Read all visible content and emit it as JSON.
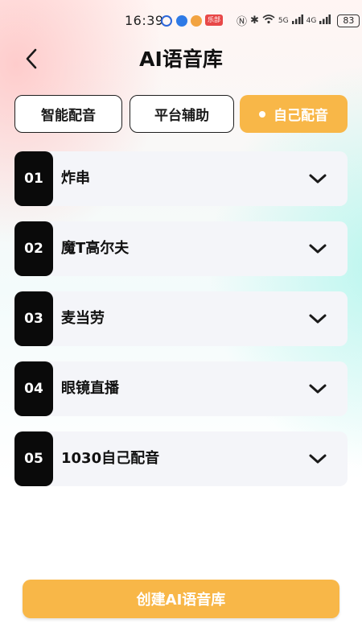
{
  "status_bar": {
    "time": "16:39",
    "badge": "乐部",
    "battery": "83",
    "net1": "5G",
    "net2": "4G"
  },
  "header": {
    "title": "AI语音库"
  },
  "tabs": [
    {
      "label": "智能配音",
      "active": false
    },
    {
      "label": "平台辅助",
      "active": false
    },
    {
      "label": "自己配音",
      "active": true
    }
  ],
  "items": [
    {
      "num": "01",
      "label": "炸串"
    },
    {
      "num": "02",
      "label": "魔T高尔夫"
    },
    {
      "num": "03",
      "label": "麦当劳"
    },
    {
      "num": "04",
      "label": "眼镜直播"
    },
    {
      "num": "05",
      "label": "1030自己配音"
    }
  ],
  "footer": {
    "create_label": "创建AI语音库"
  },
  "colors": {
    "accent": "#f8b748",
    "number_bg": "#0a0a0a",
    "item_bg": "#f4f5f9"
  },
  "icons": {
    "back": "chevron-left-icon",
    "expand": "chevron-down-icon"
  }
}
